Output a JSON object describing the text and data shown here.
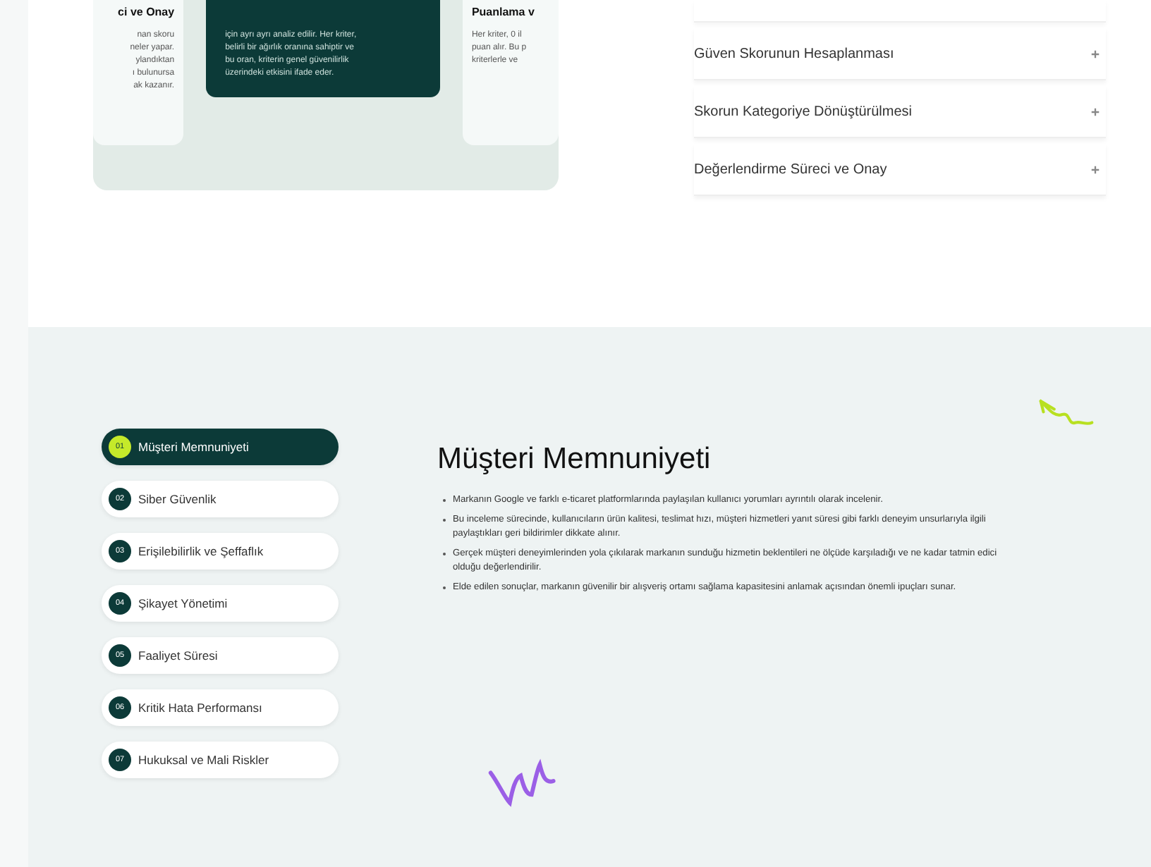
{
  "carousel": {
    "cards": [
      {
        "kind": "light",
        "title": "ci ve Onay",
        "lines": [
          "nan skoru",
          "neler yapar.",
          "ylandıktan",
          "ı bulunursa",
          "ak kazanır."
        ]
      },
      {
        "kind": "dark",
        "lines": [
          "için ayrı ayrı analiz edilir. Her kriter,",
          "belirli bir ağırlık oranına sahiptir ve",
          "bu oran, kriterin genel güvenilirlik",
          "üzerindeki etkisini ifade eder."
        ]
      },
      {
        "kind": "light",
        "title": "Puanlama v",
        "lines": [
          "Her kriter, 0 il",
          "puan alır. Bu p",
          "kriterlerle ve"
        ]
      }
    ]
  },
  "accordion": {
    "items": [
      {
        "label": "Güven Skorunun Hesaplanması",
        "expanded": false
      },
      {
        "label": "Skorun Kategoriye Dönüştürülmesi",
        "expanded": false
      },
      {
        "label": "Değerlendirme Süreci ve Onay",
        "expanded": false
      }
    ]
  },
  "criteria": {
    "tabs": [
      {
        "number": "01",
        "label": "Müşteri Memnuniyeti",
        "selected": true
      },
      {
        "number": "02",
        "label": "Siber Güvenlik",
        "selected": false
      },
      {
        "number": "03",
        "label": "Erişilebilirlik ve Şeffaflık",
        "selected": false
      },
      {
        "number": "04",
        "label": "Şikayet Yönetimi",
        "selected": false
      },
      {
        "number": "05",
        "label": "Faaliyet Süresi",
        "selected": false
      },
      {
        "number": "06",
        "label": "Kritik Hata Performansı",
        "selected": false
      },
      {
        "number": "07",
        "label": "Hukuksal ve Mali Riskler",
        "selected": false
      }
    ],
    "heading": "Müşteri Memnuniyeti",
    "bullets": [
      "Markanın Google ve farklı e-ticaret platformlarında paylaşılan kullanıcı yorumları ayrıntılı olarak incelenir.",
      "Bu inceleme sürecinde, kullanıcıların ürün kalitesi, teslimat hızı, müşteri hizmetleri yanıt süresi gibi farklı deneyim unsurlarıyla ilgili paylaştıkları geri bildirimler dikkate alınır.",
      "Gerçek müşteri deneyimlerinden yola çıkılarak markanın sunduğu hizmetin beklentileri ne ölçüde karşıladığı ve ne kadar tatmin edici olduğu değerlendirilir.",
      "Elde edilen sonuçlar, markanın güvenilir bir alışveriş ortamı sağlama kapasitesini anlamak açısından önemli ipuçları sunar."
    ]
  }
}
